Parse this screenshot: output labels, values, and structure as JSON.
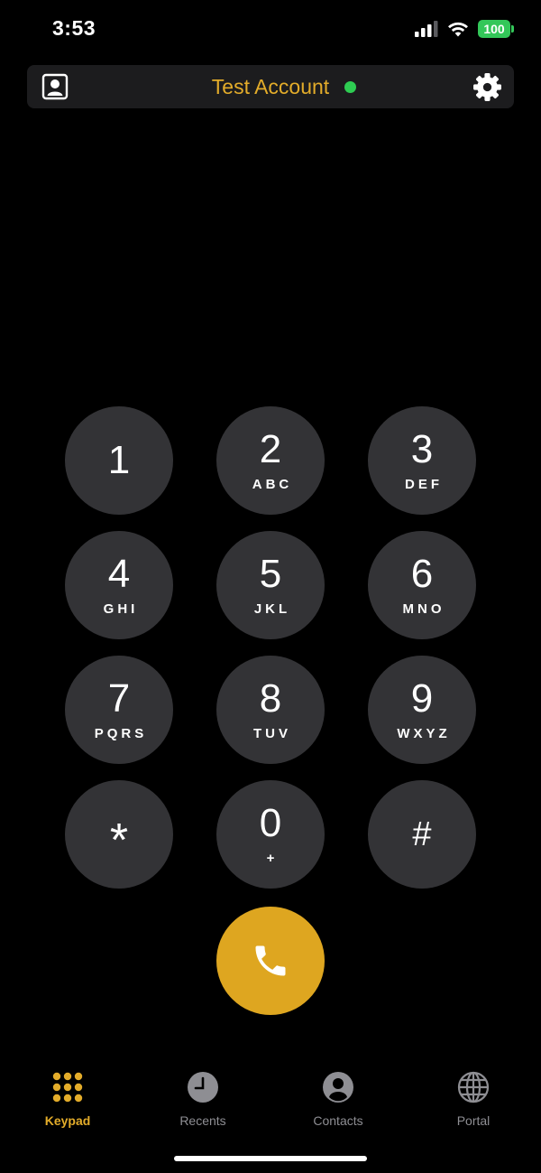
{
  "status_bar": {
    "time": "3:53",
    "battery": "100",
    "icons": [
      "signal-icon",
      "wifi-icon",
      "battery-icon"
    ]
  },
  "header": {
    "account_name": "Test Account",
    "status_color": "#2ecc52",
    "accent_color": "#e3ac2a",
    "icons": [
      "contact-card-icon",
      "gear-icon"
    ]
  },
  "keypad": {
    "keys": [
      {
        "digit": "1",
        "letters": ""
      },
      {
        "digit": "2",
        "letters": "ABC"
      },
      {
        "digit": "3",
        "letters": "DEF"
      },
      {
        "digit": "4",
        "letters": "GHI"
      },
      {
        "digit": "5",
        "letters": "JKL"
      },
      {
        "digit": "6",
        "letters": "MNO"
      },
      {
        "digit": "7",
        "letters": "PQRS"
      },
      {
        "digit": "8",
        "letters": "TUV"
      },
      {
        "digit": "9",
        "letters": "WXYZ"
      },
      {
        "digit": "*",
        "letters": ""
      },
      {
        "digit": "0",
        "letters": "+"
      },
      {
        "digit": "#",
        "letters": ""
      }
    ],
    "call_icon": "phone-icon",
    "call_color": "#dea620"
  },
  "tabs": [
    {
      "label": "Keypad",
      "icon": "keypad-grid-icon",
      "active": true
    },
    {
      "label": "Recents",
      "icon": "clock-icon",
      "active": false
    },
    {
      "label": "Contacts",
      "icon": "person-icon",
      "active": false
    },
    {
      "label": "Portal",
      "icon": "globe-icon",
      "active": false
    }
  ]
}
